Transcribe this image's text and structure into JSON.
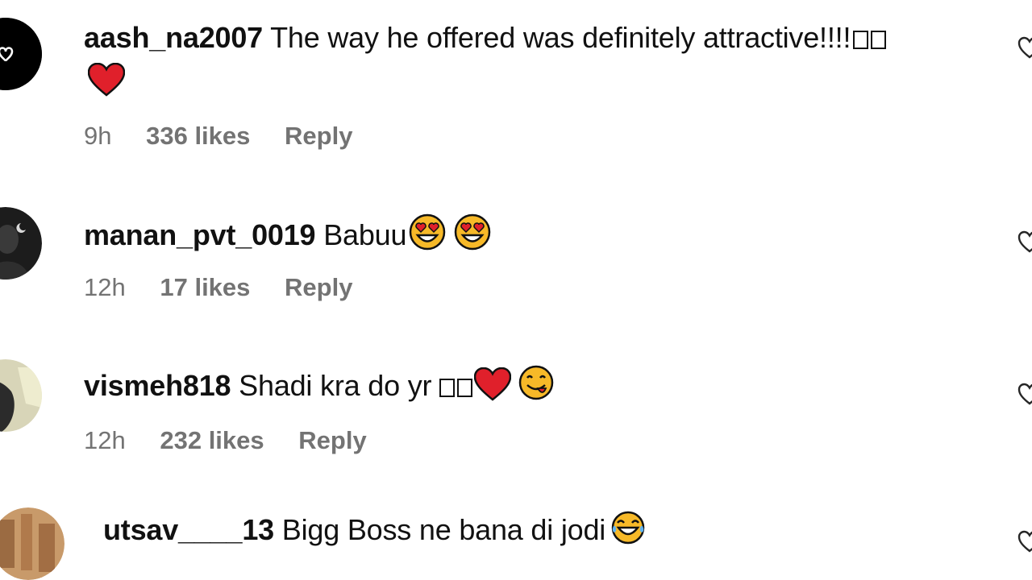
{
  "comments": [
    {
      "username": "aash_na2007",
      "text": "The way he offered was definitely attractive!!!!",
      "time": "9h",
      "likes": "336 likes",
      "reply": "Reply",
      "avatar_color": "#000000"
    },
    {
      "username": "manan_pvt_0019",
      "text": "Babuu",
      "time": "12h",
      "likes": "17 likes",
      "reply": "Reply",
      "avatar_color": "#2a2a2a"
    },
    {
      "username": "vismeh818",
      "text": "Shadi kra do yr",
      "time": "12h",
      "likes": "232 likes",
      "reply": "Reply",
      "avatar_color": "#c9c7a8"
    },
    {
      "username": "utsav____13",
      "text": "Bigg Boss ne bana di jodi",
      "avatar_color": "#c89a6a"
    }
  ],
  "icons": {
    "like": "heart-outline-icon",
    "emoji_heart": "red-heart-emoji",
    "emoji_heart_eyes": "heart-eyes-emoji",
    "emoji_yum": "face-savoring-food-emoji",
    "emoji_laugh": "tears-of-joy-emoji"
  },
  "colors": {
    "meta_text": "#737373",
    "heart_red": "#e0202b",
    "emoji_yellow": "#f7b928"
  }
}
